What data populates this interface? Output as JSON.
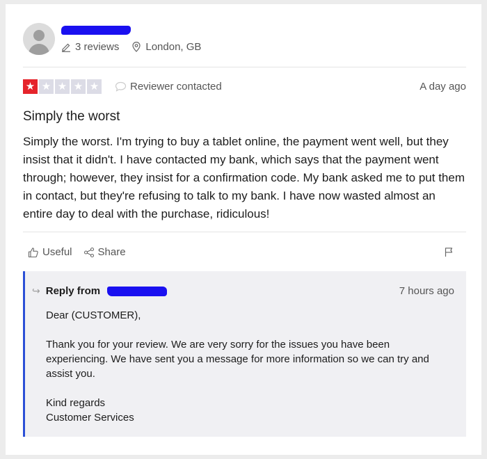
{
  "reviewer": {
    "reviews_count": "3 reviews",
    "location": "London, GB"
  },
  "review": {
    "rating": 1,
    "max_rating": 5,
    "star_color": "#e5242b",
    "empty_star_color": "#dcdce6",
    "status": "Reviewer contacted",
    "date": "A day ago",
    "title": "Simply the worst",
    "text": "Simply the worst. I'm trying to buy a tablet online, the payment went well, but they insist that it didn't. I have contacted my bank, which says that the payment went through; however, they insist for a confirmation code. My bank asked me to put them in contact, but they're refusing to talk to my bank. I have now wasted almost an entire day to deal with the purchase, ridiculous!"
  },
  "actions": {
    "useful_label": "Useful",
    "share_label": "Share"
  },
  "reply": {
    "heading": "Reply from",
    "date": "7 hours ago",
    "greeting": "Dear (CUSTOMER),",
    "body": "Thank you for your review. We are very sorry for the issues you have been experiencing. We have sent you a message for more information so we can try and assist you.",
    "closing": "Kind regards",
    "signature": "Customer Services",
    "accent_color": "#2b4fd6"
  },
  "icons": {
    "avatar": "user-avatar-icon",
    "reviews": "pencil-icon",
    "location": "map-pin-icon",
    "status": "speech-bubble-icon",
    "useful": "thumbs-up-icon",
    "share": "share-icon",
    "flag": "flag-icon",
    "reply": "reply-arrow-icon"
  }
}
